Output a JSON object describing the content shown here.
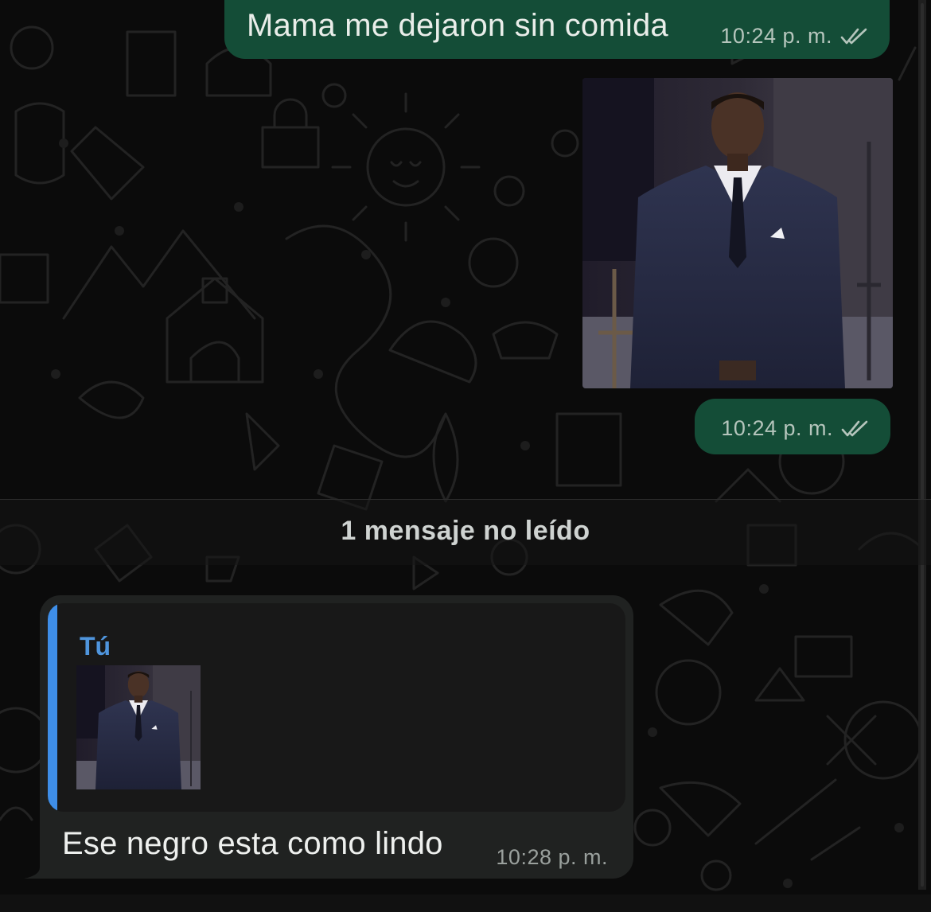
{
  "messages": {
    "outgoing_1": {
      "text": "Mama me dejaron sin comida",
      "time": "10:24 p. m.",
      "status_icon": "double-check-icon"
    },
    "outgoing_2": {
      "type": "photo",
      "time": "10:24 p. m.",
      "status_icon": "double-check-icon"
    },
    "unread_divider": {
      "label": "1 mensaje no leído"
    },
    "incoming_1": {
      "reply_to": {
        "author": "Tú",
        "attachment": "photo-thumbnail"
      },
      "text": "Ese negro esta como lindo",
      "time": "10:28 p. m."
    }
  },
  "colors": {
    "outgoing_bubble": "#144d37",
    "incoming_bubble": "#202221",
    "quote_accent": "#3e8ee8",
    "background": "#0b0b0b"
  }
}
